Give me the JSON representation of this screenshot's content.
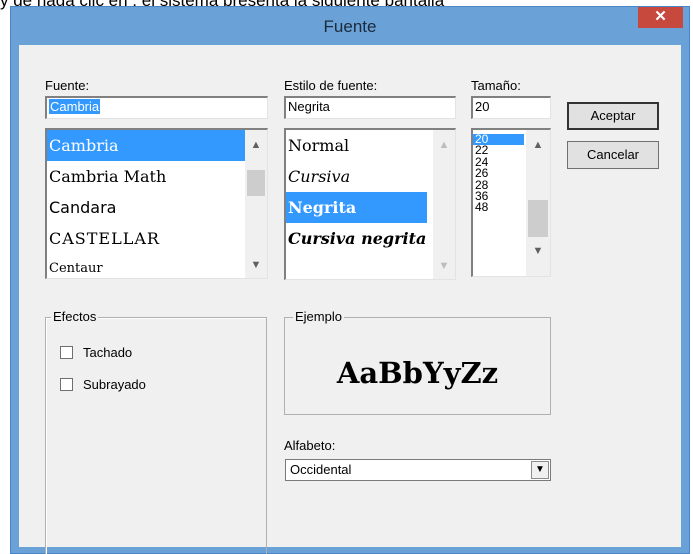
{
  "caption": "y de haga clic en  , el sistema presenta la siguiente pantalla",
  "window": {
    "title": "Fuente",
    "close_symbol": "✕"
  },
  "font": {
    "label": "Fuente:",
    "value": "Cambria",
    "items": [
      "Cambria",
      "Cambria Math",
      "Candara",
      "CASTELLAR",
      "Centaur"
    ],
    "selected_index": 0
  },
  "style": {
    "label": "Estilo de fuente:",
    "value": "Negrita",
    "items": [
      "Normal",
      "Cursiva",
      "Negrita",
      "Cursiva negrita"
    ],
    "selected_index": 2
  },
  "size": {
    "label": "Tamaño:",
    "value": "20",
    "items": [
      "20",
      "22",
      "24",
      "26",
      "28",
      "36",
      "48"
    ],
    "selected_index": 0
  },
  "buttons": {
    "accept": "Aceptar",
    "cancel": "Cancelar"
  },
  "effects": {
    "label": "Efectos",
    "strikeout": {
      "label": "Tachado",
      "checked": false
    },
    "underline": {
      "label": "Subrayado",
      "checked": false
    }
  },
  "sample": {
    "label": "Ejemplo",
    "text": "AaBbYyZz"
  },
  "script": {
    "label": "Alfabeto:",
    "value": "Occidental"
  },
  "colors": {
    "titlebar": "#6aa2d8",
    "selection": "#3399ff",
    "close": "#c7483d"
  },
  "icons": {
    "close": "close-icon",
    "scroll_up": "chevron-up-icon",
    "scroll_down": "chevron-down-icon",
    "dropdown": "triangle-down-icon"
  }
}
